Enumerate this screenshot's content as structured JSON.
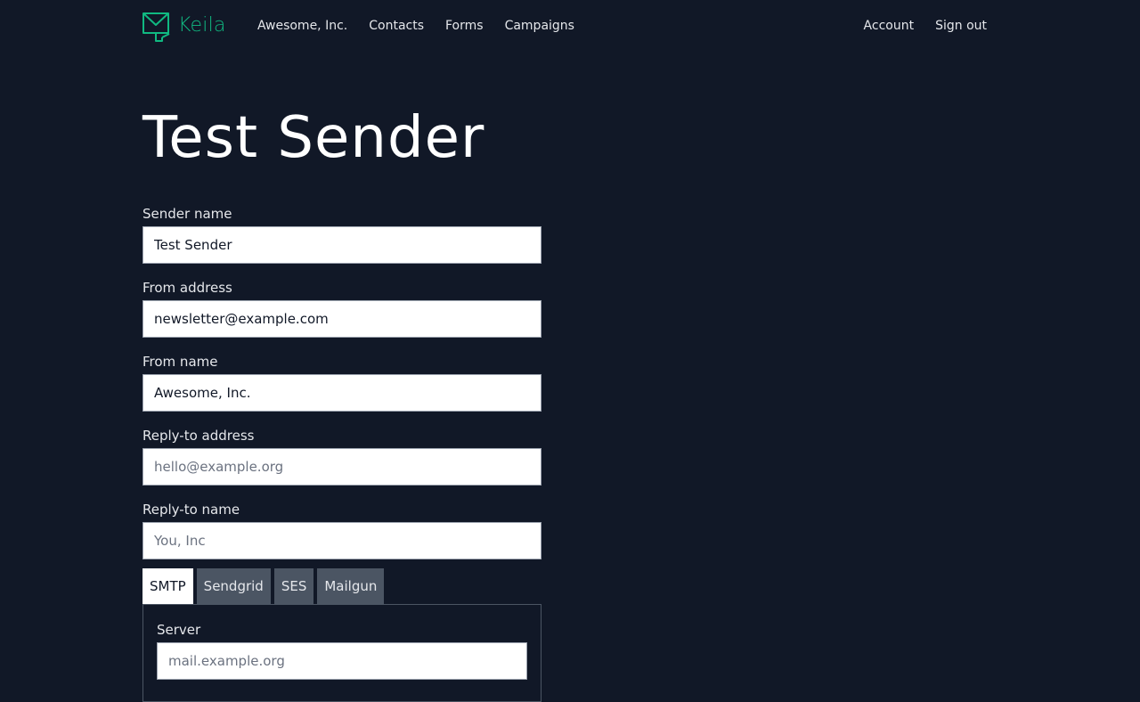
{
  "nav": {
    "logo_text": "Keila",
    "links": [
      "Awesome, Inc.",
      "Contacts",
      "Forms",
      "Campaigns"
    ],
    "right_links": [
      "Account",
      "Sign out"
    ],
    "brand_color": "#10b981"
  },
  "page": {
    "title": "Test Sender"
  },
  "form": {
    "sender_name": {
      "label": "Sender name",
      "value": "Test Sender"
    },
    "from_address": {
      "label": "From address",
      "value": "newsletter@example.com"
    },
    "from_name": {
      "label": "From name",
      "value": "Awesome, Inc."
    },
    "reply_to_address": {
      "label": "Reply-to address",
      "placeholder": "hello@example.org"
    },
    "reply_to_name": {
      "label": "Reply-to name",
      "placeholder": "You, Inc"
    }
  },
  "tabs": {
    "items": [
      "SMTP",
      "Sendgrid",
      "SES",
      "Mailgun"
    ],
    "active": "SMTP"
  },
  "smtp": {
    "server": {
      "label": "Server",
      "placeholder": "mail.example.org"
    }
  }
}
